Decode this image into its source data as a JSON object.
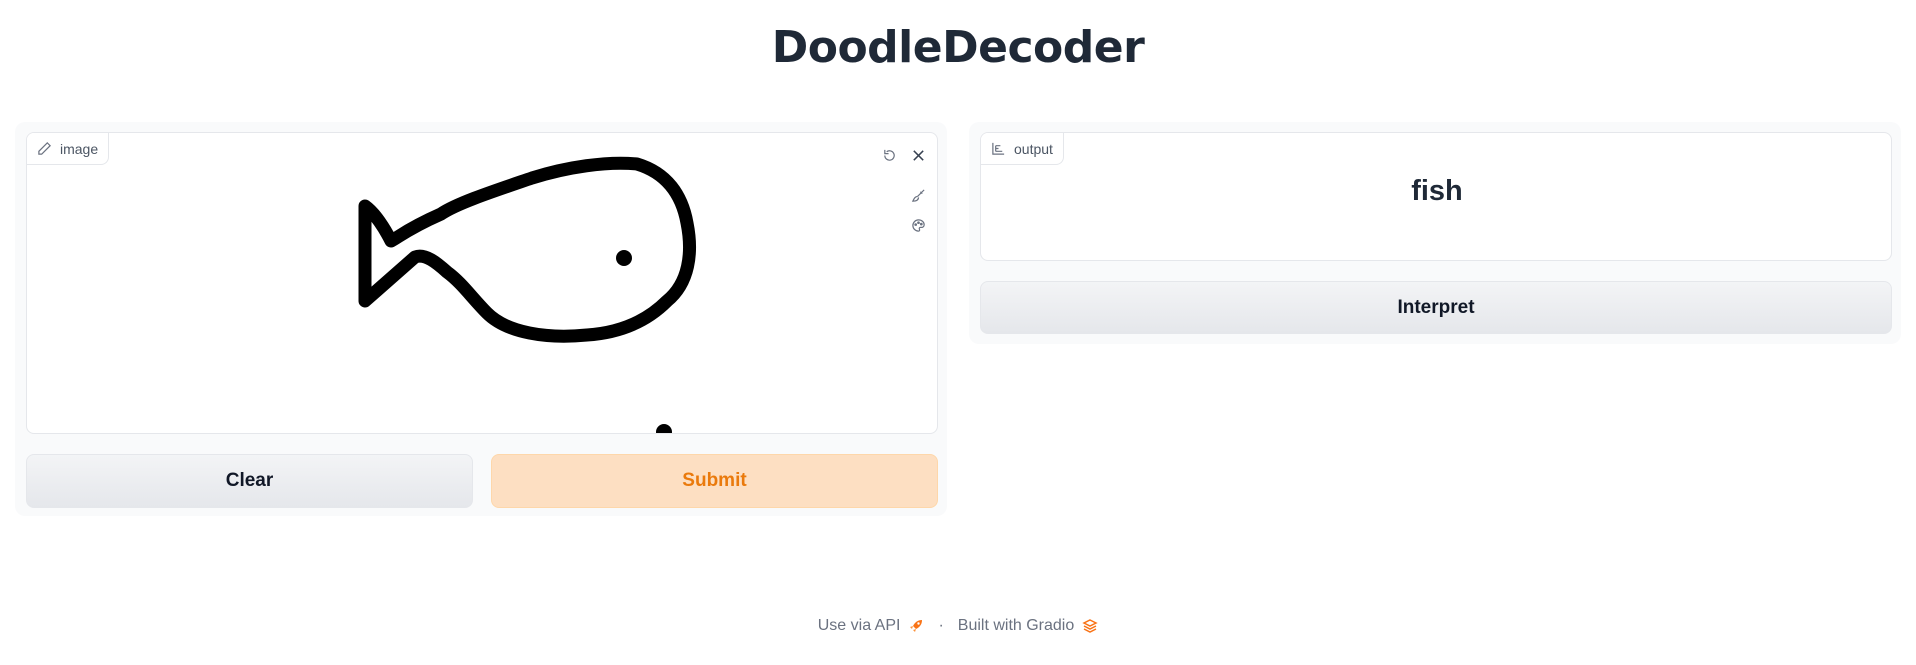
{
  "app": {
    "title": "DoodleDecoder"
  },
  "input": {
    "label": "image",
    "label_icon": "pencil-icon",
    "tools": [
      "undo-icon",
      "close-icon",
      "brush-icon",
      "palette-icon"
    ],
    "drawing": "fish doodle"
  },
  "output": {
    "label": "output",
    "label_icon": "bar-chart-icon",
    "value": "fish"
  },
  "buttons": {
    "clear": "Clear",
    "submit": "Submit",
    "interpret": "Interpret"
  },
  "footer": {
    "api_link": "Use via API",
    "separator": "·",
    "built_with": "Built with Gradio"
  },
  "colors": {
    "primary_bg": "#fddfc2",
    "primary_text": "#ea7a0c",
    "title": "#1f2937"
  }
}
